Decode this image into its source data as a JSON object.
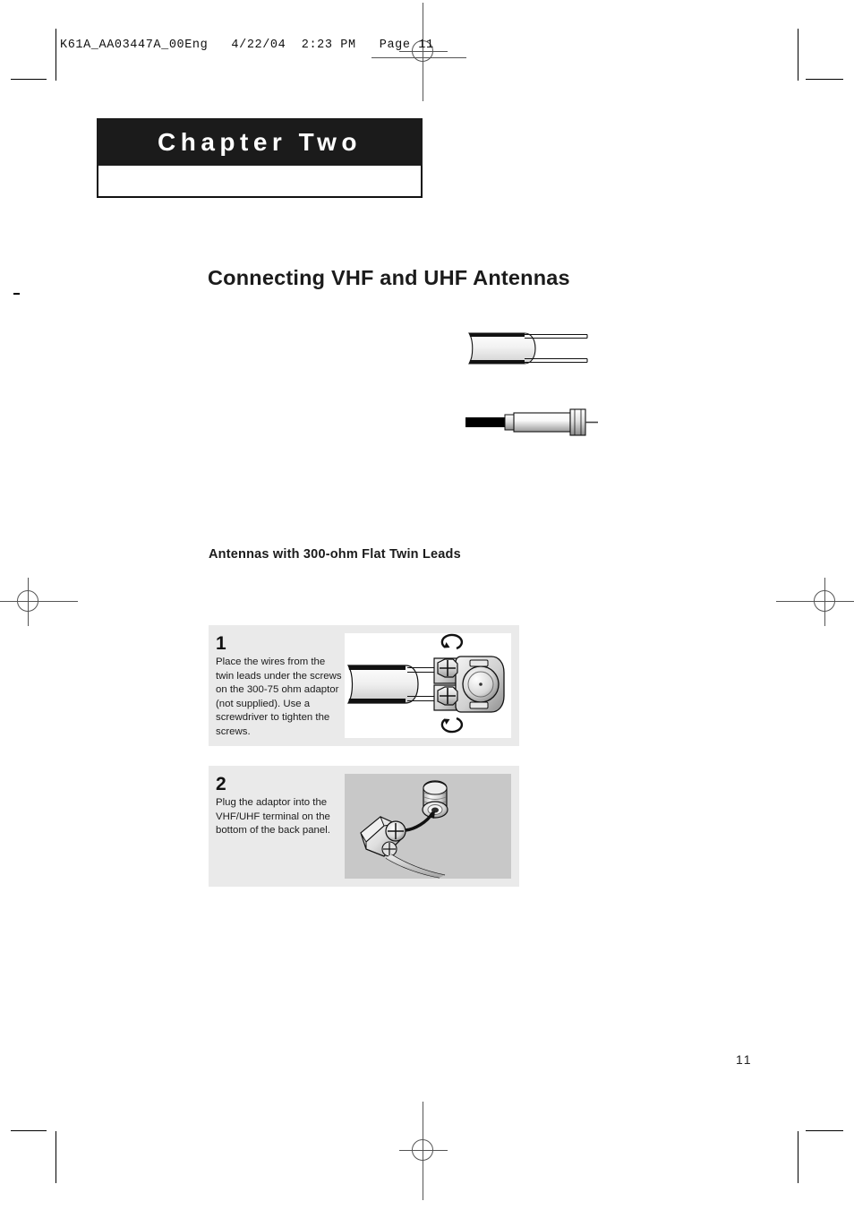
{
  "document": {
    "running_header": "K61A_AA03447A_00Eng   4/22/04  2:23 PM   Page 11",
    "page_number": "11"
  },
  "chapter": {
    "title": "Chapter Two"
  },
  "headings": {
    "section_title": "Connecting VHF and UHF Antennas",
    "sub_title": "Antennas with 300-ohm Flat Twin Leads"
  },
  "illustrations": {
    "twin_lead": "flat-twin-lead-cable-illustration",
    "coax": "coaxial-cable-with-f-connector-illustration"
  },
  "steps": [
    {
      "number": "1",
      "text": "Place the wires from the twin leads under the screws on the 300-75 ohm adaptor (not supplied). Use a screwdriver to tighten the screws.",
      "figure": "twin-lead-into-300-75-ohm-adaptor-diagram",
      "figure_background": "#ffffff"
    },
    {
      "number": "2",
      "text": "Plug the adaptor into the VHF/UHF terminal on the bottom of the back panel.",
      "figure": "adaptor-into-vhf-uhf-terminal-diagram",
      "figure_background": "#c8c8c8"
    }
  ],
  "colors": {
    "chapter_bar": "#1b1b1b",
    "panel_background": "#eaeaea",
    "text": "#1b1b1b"
  }
}
